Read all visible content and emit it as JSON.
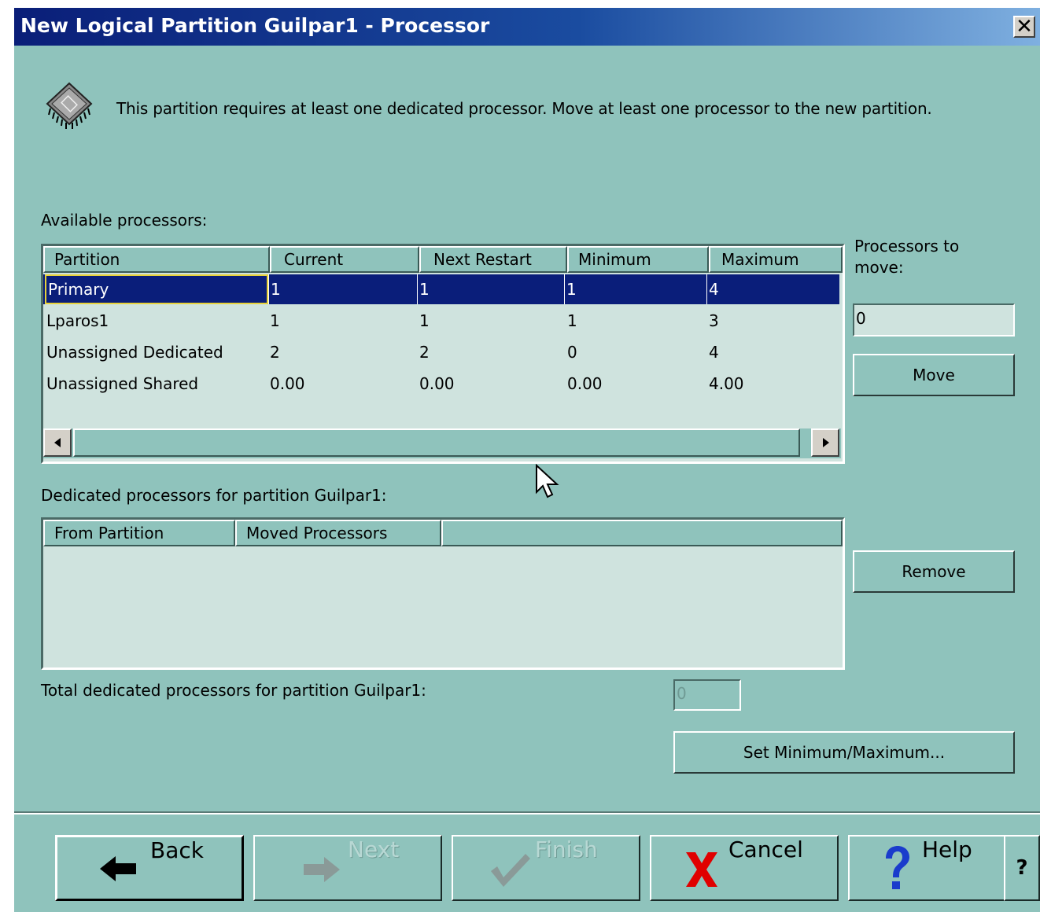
{
  "window": {
    "title": "New Logical Partition Guilpar1 - Processor",
    "close_label": "✕"
  },
  "message": "This partition requires at least one dedicated processor.  Move at least one processor to the new partition.",
  "available": {
    "label": "Available processors:",
    "headers": [
      "Partition",
      "Current",
      "Next Restart",
      "Minimum",
      "Maximum"
    ],
    "rows": [
      [
        "Primary",
        "1",
        "1",
        "1",
        "4"
      ],
      [
        "Lparos1",
        "1",
        "1",
        "1",
        "3"
      ],
      [
        "Unassigned Dedicated",
        "2",
        "2",
        "0",
        "4"
      ],
      [
        "Unassigned Shared",
        "0.00",
        "0.00",
        "0.00",
        "4.00"
      ]
    ],
    "selected_row": 0
  },
  "move_panel": {
    "label": "Processors to move:",
    "value": "0",
    "move_button": "Move",
    "remove_button": "Remove"
  },
  "dedicated": {
    "label": "Dedicated processors for partition Guilpar1:",
    "headers": [
      "From Partition",
      "Moved Processors",
      ""
    ]
  },
  "total": {
    "label": "Total dedicated processors for partition Guilpar1:",
    "value": "0"
  },
  "set_minmax_button": "Set Minimum/Maximum...",
  "nav": {
    "back": "Back",
    "next": "Next",
    "finish": "Finish",
    "cancel": "Cancel",
    "help": "Help",
    "whats_this": "?"
  },
  "colors": {
    "background": "#8fc3bc",
    "title_gradient_start": "#0a1e78",
    "selection": "#0a1e7a",
    "cancel_x": "#e00000",
    "help_question": "#1a3ccc"
  }
}
